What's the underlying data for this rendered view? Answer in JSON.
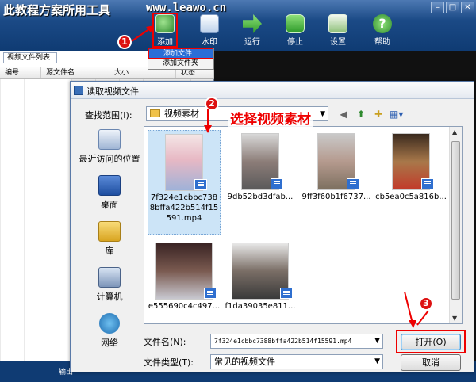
{
  "app": {
    "title": "此教程方案所用工具",
    "site": "www.leawo.cn",
    "window_buttons": [
      "–",
      "□",
      "✕"
    ]
  },
  "toolbar": {
    "add": "添加",
    "watermark": "水印",
    "run": "运行",
    "stop": "停止",
    "settings": "设置",
    "help": "帮助"
  },
  "add_menu": {
    "items": [
      "添加文件",
      "添加文件夹"
    ]
  },
  "left_panel": {
    "tab": "视频文件列表",
    "columns": [
      "编号",
      "源文件名",
      "大小",
      "状态"
    ]
  },
  "status_bar": {
    "text": "输出"
  },
  "dialog": {
    "title": "读取视频文件",
    "look_in_label": "查找范围(I):",
    "look_in_value": "视频素材",
    "places": [
      "最近访问的位置",
      "桌面",
      "库",
      "计算机",
      "网络"
    ],
    "files": [
      "7f324e1cbbc7388bffa422b514f15591.mp4",
      "9db52bd3dfab...",
      "9ff3f60b1f6737...",
      "cb5ea0c5a816b...",
      "e555690c4c497...",
      "f1da39035e811..."
    ],
    "file_name_label": "文件名(N):",
    "file_name_value": "7f324e1cbbc7388bffa422b514f15591.mp4",
    "file_type_label": "文件类型(T):",
    "file_type_value": "常见的视频文件",
    "open_button": "打开(O)",
    "cancel_button": "取消"
  },
  "annotations": {
    "step1": "1",
    "step2": "2",
    "step3": "3",
    "select_text": "选择视频素材"
  },
  "colors": {
    "accent_red": "#e00000",
    "toolbar_blue": "#1b4a86",
    "selection": "#cce4f7"
  }
}
